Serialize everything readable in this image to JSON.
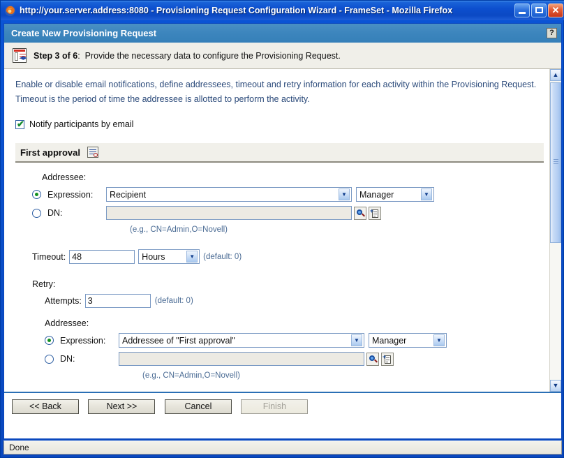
{
  "window": {
    "title": "http://your.server.address:8080 - Provisioning Request Configuration Wizard - FrameSet - Mozilla Firefox",
    "minimize_label": "Minimize",
    "maximize_label": "Maximize",
    "close_label": "✕"
  },
  "app_header": {
    "title": "Create New Provisioning Request",
    "help_label": "?"
  },
  "step": {
    "label": "Step 3 of 6",
    "separator": ":",
    "description": "Provide the necessary data to configure the Provisioning Request."
  },
  "intro": {
    "text": "Enable or disable email notifications, define addressees, timeout and retry information for each activity within the Provisioning Request.  Timeout is the period of time the addressee is allotted to perform the activity."
  },
  "notify": {
    "label": "Notify participants by email",
    "checked": true,
    "check_glyph": "✔"
  },
  "section": {
    "title": "First approval"
  },
  "addressee": {
    "label": "Addressee:",
    "expression_label": "Expression:",
    "dn_label": "DN:",
    "expression_value": "Recipient",
    "relation_value": "Manager",
    "dn_value": "",
    "dn_hint": "(e.g., CN=Admin,O=Novell)",
    "selected": "expression"
  },
  "timeout": {
    "label": "Timeout:",
    "value": "48",
    "unit": "Hours",
    "default_hint": "(default: 0)"
  },
  "retry": {
    "label": "Retry:",
    "attempts_label": "Attempts:",
    "attempts_value": "3",
    "attempts_default_hint": "(default: 0)",
    "addressee_label": "Addressee:",
    "expression_label": "Expression:",
    "dn_label": "DN:",
    "expression_value": "Addressee of \"First approval\"",
    "relation_value": "Manager",
    "dn_value": "",
    "dn_hint": "(e.g., CN=Admin,O=Novell)",
    "selected": "expression"
  },
  "buttons": {
    "back": "<< Back",
    "next": "Next >>",
    "cancel": "Cancel",
    "finish": "Finish"
  },
  "statusbar": {
    "text": "Done"
  },
  "scrollbar": {
    "up_glyph": "▲",
    "down_glyph": "▼"
  },
  "select_arrow_glyph": "▼"
}
